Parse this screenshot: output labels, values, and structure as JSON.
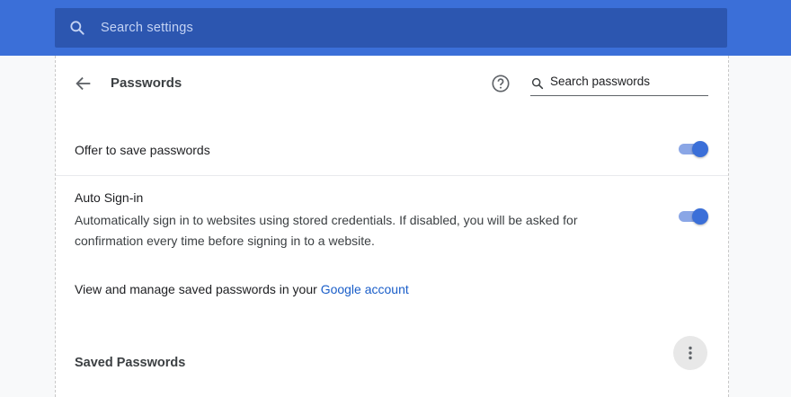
{
  "top_search": {
    "placeholder": "Search settings",
    "icon": "search-icon"
  },
  "header": {
    "title": "Passwords",
    "back_icon": "arrow-back-icon",
    "help_icon": "help-icon",
    "search_placeholder": "Search passwords"
  },
  "offer_save": {
    "label": "Offer to save passwords",
    "enabled": true
  },
  "auto_signin": {
    "label": "Auto Sign-in",
    "description": "Automatically sign in to websites using stored credentials. If disabled, you will be asked for confirmation every time before signing in to a website.",
    "enabled": true
  },
  "manage": {
    "text": "View and manage saved passwords in your ",
    "link": "Google account"
  },
  "saved": {
    "heading": "Saved Passwords",
    "more_icon": "more-vert-icon"
  },
  "colors": {
    "accent": "#3b6fd8",
    "topbar": "#3b6fd8",
    "link": "#1a5ec9"
  }
}
